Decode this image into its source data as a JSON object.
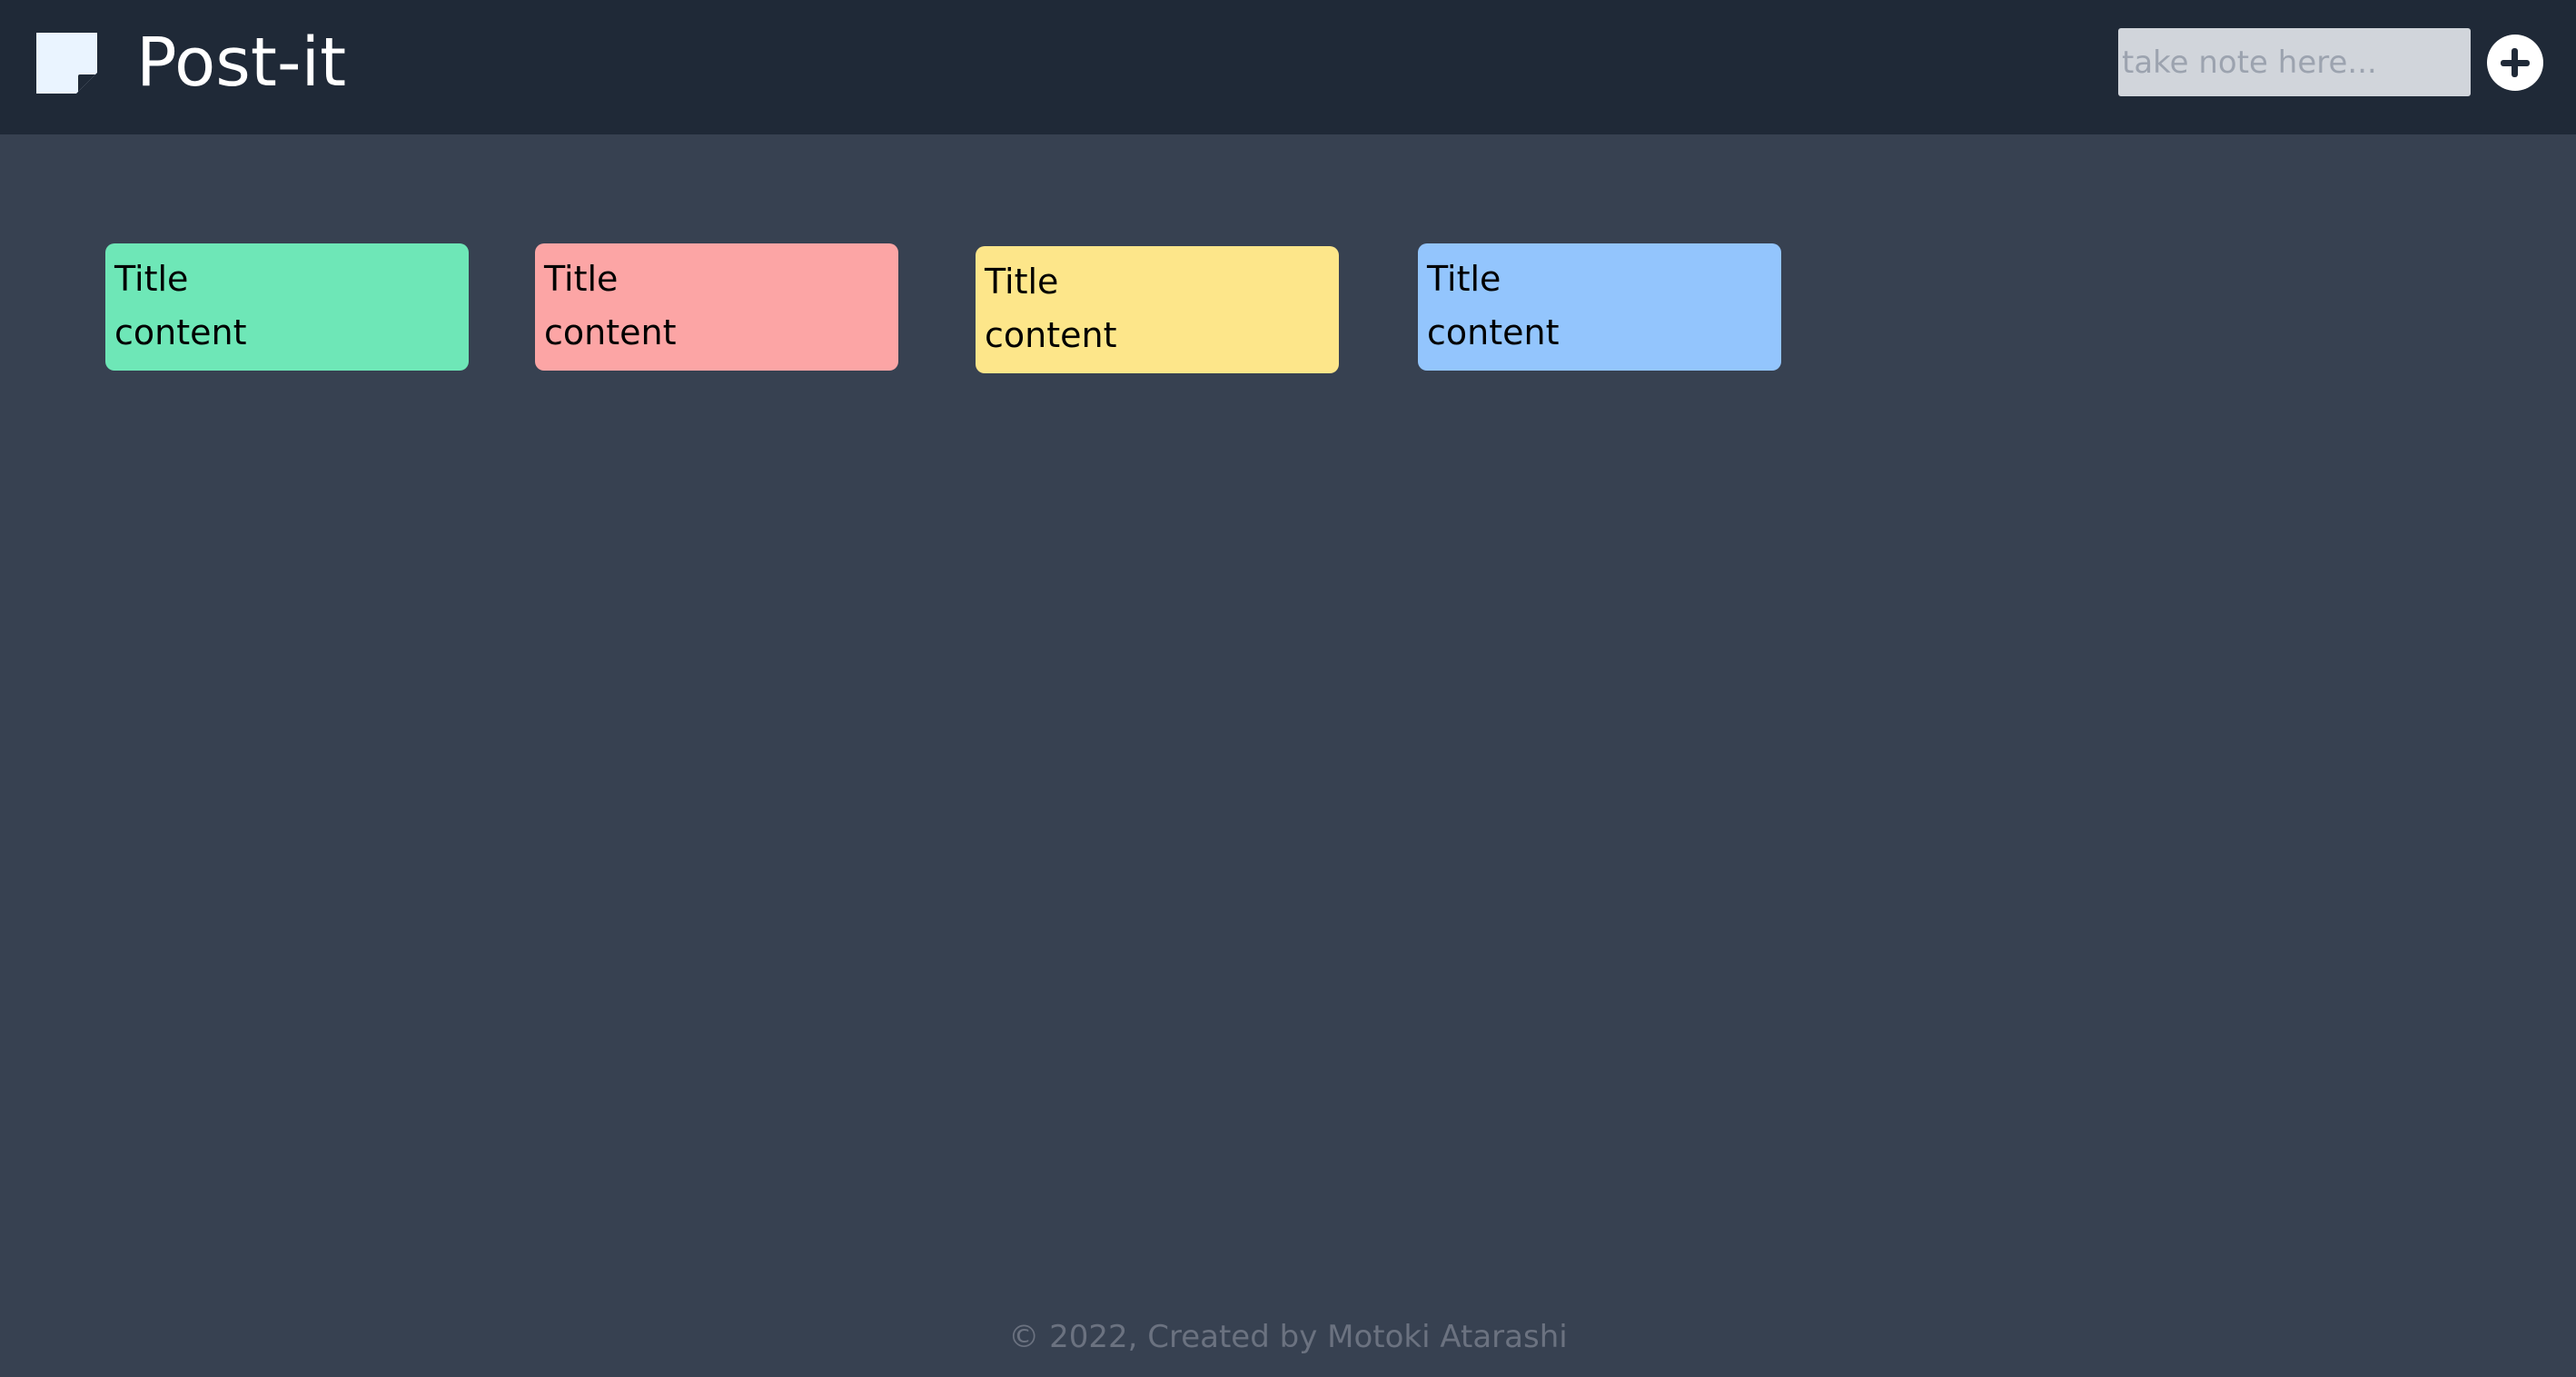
{
  "header": {
    "app_title": "Post-it",
    "logo_icon": "sticky-note-icon",
    "note_input": {
      "value": "",
      "placeholder": "take note here..."
    },
    "add_button_icon": "plus-circle-icon"
  },
  "notes": [
    {
      "title": "Title",
      "content": "content",
      "color": "#6ee7b7"
    },
    {
      "title": "Title",
      "content": "content",
      "color": "#fca5a5"
    },
    {
      "title": "Title",
      "content": "content",
      "color": "#fde68a"
    },
    {
      "title": "Title",
      "content": "content",
      "color": "#93c5fd"
    }
  ],
  "footer": {
    "text": "© 2022, Created by Motoki Atarashi"
  },
  "colors": {
    "header_bg": "#1f2937",
    "page_bg": "#374151",
    "input_bg": "#d1d5db"
  }
}
